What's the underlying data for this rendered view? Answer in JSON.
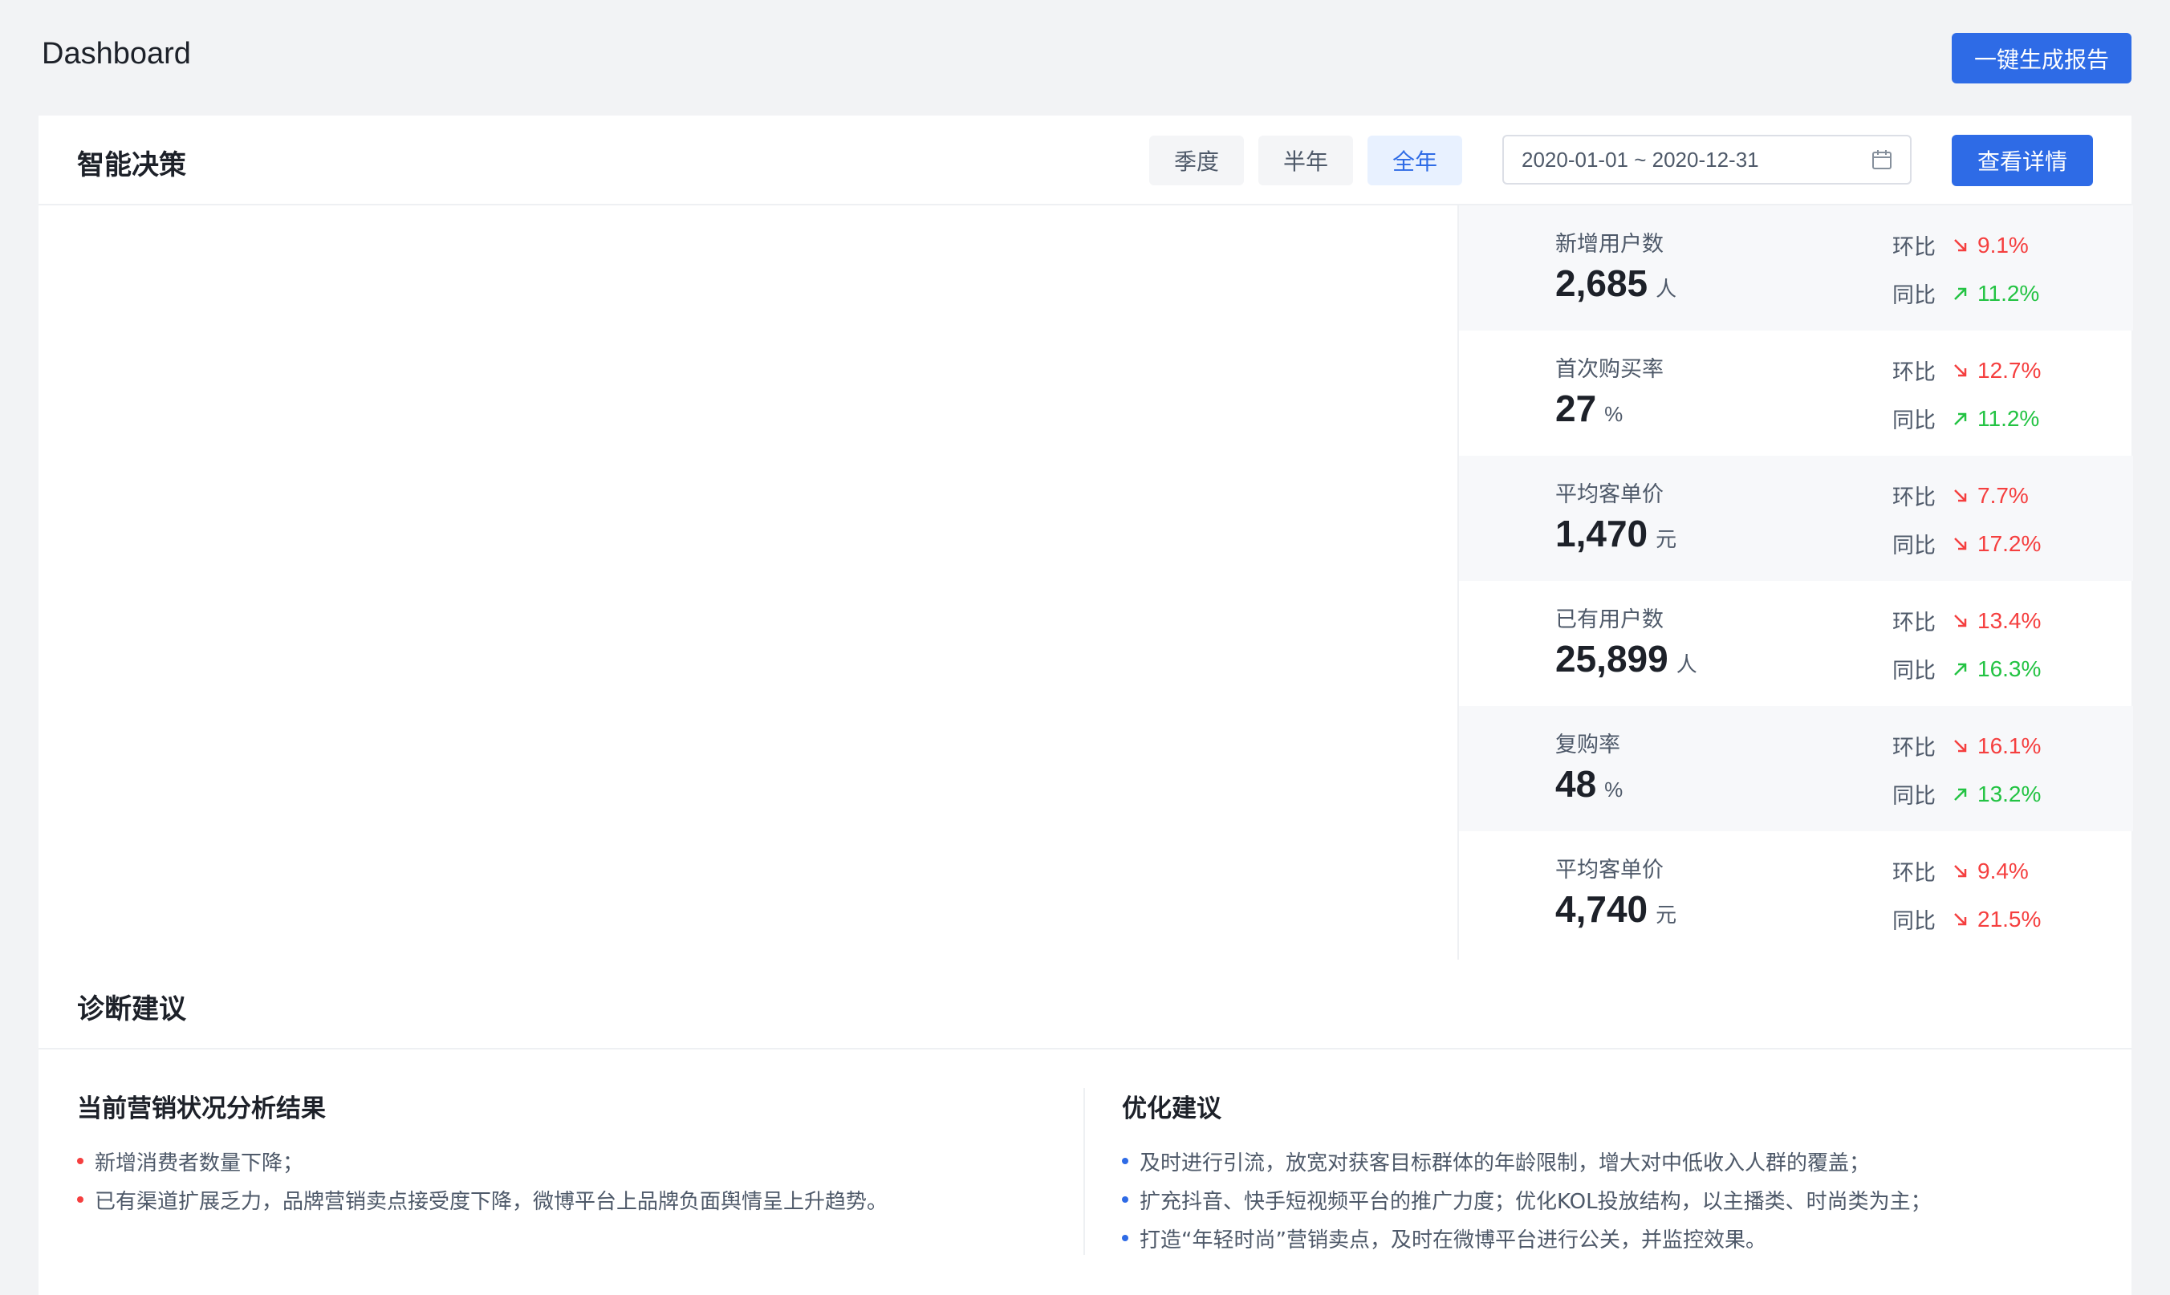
{
  "page_title": "Dashboard",
  "generate_report_label": "一键生成报告",
  "decision": {
    "title": "智能决策",
    "segments": [
      "季度",
      "半年",
      "全年"
    ],
    "active_segment": "全年",
    "date_range": "2020-01-01 ~ 2020-12-31",
    "view_detail_label": "查看详情",
    "mom_label": "环比",
    "yoy_label": "同比",
    "metrics": [
      {
        "label": "新增用户数",
        "value": "2,685",
        "unit": "人",
        "mom": "9.1%",
        "mom_trend": "down",
        "yoy": "11.2%",
        "yoy_trend": "up"
      },
      {
        "label": "首次购买率",
        "value": "27",
        "unit": "%",
        "mom": "12.7%",
        "mom_trend": "down",
        "yoy": "11.2%",
        "yoy_trend": "up"
      },
      {
        "label": "平均客单价",
        "value": "1,470",
        "unit": "元",
        "mom": "7.7%",
        "mom_trend": "down",
        "yoy": "17.2%",
        "yoy_trend": "down"
      },
      {
        "label": "已有用户数",
        "value": "25,899",
        "unit": "人",
        "mom": "13.4%",
        "mom_trend": "down",
        "yoy": "16.3%",
        "yoy_trend": "up"
      },
      {
        "label": "复购率",
        "value": "48",
        "unit": "%",
        "mom": "16.1%",
        "mom_trend": "down",
        "yoy": "13.2%",
        "yoy_trend": "up"
      },
      {
        "label": "平均客单价",
        "value": "4,740",
        "unit": "元",
        "mom": "9.4%",
        "mom_trend": "down",
        "yoy": "21.5%",
        "yoy_trend": "down"
      }
    ]
  },
  "advice": {
    "title": "诊断建议",
    "analysis": {
      "heading": "当前营销状况分析结果",
      "items": [
        "新增消费者数量下降；",
        "已有渠道扩展乏力，品牌营销卖点接受度下降，微博平台上品牌负面舆情呈上升趋势。"
      ]
    },
    "optimize": {
      "heading": "优化建议",
      "items": [
        "及时进行引流，放宽对获客目标群体的年龄限制，增大对中低收入人群的覆盖；",
        "扩充抖音、快手短视频平台的推广力度；优化KOL投放结构，以主播类、时尚类为主；",
        "打造“年轻时尚”营销卖点，及时在微博平台进行公关，并监控效果。"
      ]
    }
  },
  "colors": {
    "primary": "#2e6be6",
    "down": "#f53f3f",
    "up": "#23c343"
  }
}
